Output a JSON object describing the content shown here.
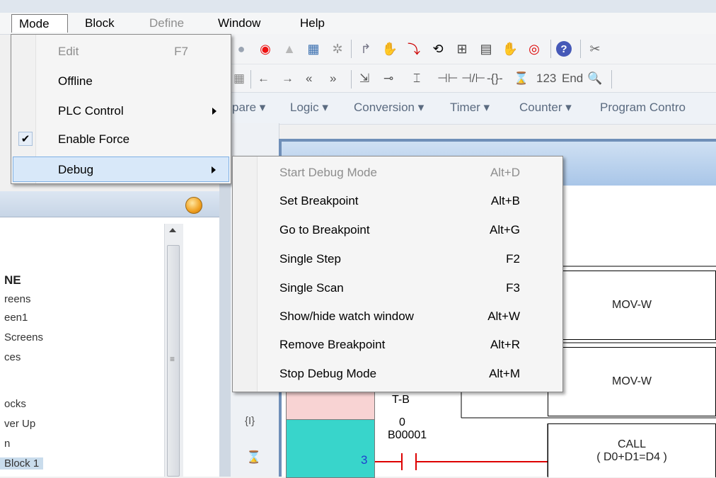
{
  "menubar": {
    "items": [
      {
        "label": "Mode",
        "state": "open"
      },
      {
        "label": "Block",
        "state": "normal"
      },
      {
        "label": "Define",
        "state": "disabled"
      },
      {
        "label": "Window",
        "state": "normal"
      },
      {
        "label": "Help",
        "state": "normal"
      }
    ]
  },
  "mode_menu": {
    "items": [
      {
        "label": "Edit",
        "shortcut": "F7",
        "disabled": true
      },
      {
        "label": "Offline",
        "shortcut": ""
      },
      {
        "label": "PLC Control",
        "shortcut": "",
        "submenu": true
      },
      {
        "label": "Enable Force",
        "shortcut": "",
        "checked": true
      },
      {
        "label": "Debug",
        "shortcut": "",
        "submenu": true,
        "highlighted": true
      }
    ]
  },
  "debug_menu": {
    "items": [
      {
        "label": "Start Debug Mode",
        "shortcut": "Alt+D",
        "disabled": true
      },
      {
        "label": "Set Breakpoint",
        "shortcut": "Alt+B"
      },
      {
        "label": "Go to Breakpoint",
        "shortcut": "Alt+G"
      },
      {
        "label": "Single Step",
        "shortcut": "F2"
      },
      {
        "label": "Single Scan",
        "shortcut": "F3"
      },
      {
        "label": "Show/hide watch window",
        "shortcut": "Alt+W"
      },
      {
        "label": "Remove Breakpoint",
        "shortcut": "Alt+R"
      },
      {
        "label": "Stop Debug Mode",
        "shortcut": "Alt+M"
      }
    ]
  },
  "toolbar2": {
    "text_123": "123",
    "text_end": "End"
  },
  "toolbar3": {
    "categories": [
      "pare ▾",
      "Logic ▾",
      "Conversion ▾",
      "Timer ▾",
      "Counter ▾",
      "Program Contro"
    ]
  },
  "project_tree": {
    "items": [
      "NE",
      "reens",
      "een1",
      "Screens",
      "ces",
      "ocks",
      "ver Up",
      "n",
      "Block 1"
    ]
  },
  "ladder": {
    "blocks": [
      {
        "label": "MOV-W"
      },
      {
        "label": "MOV-W"
      },
      {
        "label": "CALL",
        "sub": "( D0+D1=D4 )"
      }
    ],
    "contact_labels": [
      "T-B",
      "0",
      "B00001"
    ],
    "rung_number": "3",
    "side_glyph": "{I}"
  },
  "colors": {
    "menu_highlight": "#d8e8f9",
    "pink_cell": "#f8d3d3",
    "teal_cell": "#38d5cb",
    "editor_title": "#a9c6e8"
  }
}
